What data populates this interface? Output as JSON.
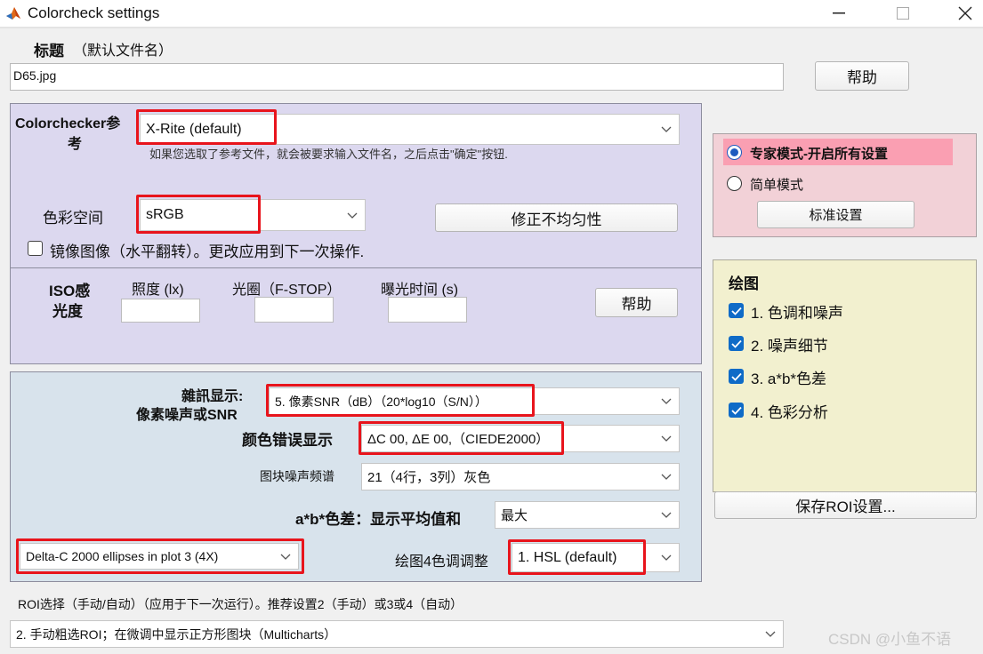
{
  "window": {
    "title": "Colorcheck settings",
    "controls": {
      "minimize": "–",
      "maximize": "☐",
      "close": "✕"
    }
  },
  "title_section": {
    "label": "标题",
    "label_hint": "（默认文件名）",
    "value": "D65.jpg",
    "help_button": "帮助"
  },
  "reference": {
    "label_line1": "Colorchecker参",
    "label_line2": "考",
    "select_value": "X-Rite (default)",
    "hint": "如果您选取了参考文件，就会被要求输入文件名，之后点击\"确定\"按钮.",
    "colorspace_label": "色彩空间",
    "colorspace_value": "sRGB",
    "nonuniformity_button": "修正不均匀性",
    "mirror_label": "镜像图像（水平翻转）。更改应用到下一次操作.",
    "mirror_checked": false
  },
  "exposure": {
    "iso_line1": "ISO感",
    "iso_line2": "光度",
    "illuminance_label": "照度 (lx)",
    "aperture_label": "光圈（F-STOP）",
    "exposure_time_label": "曝光时间 (s)",
    "illuminance_value": "",
    "aperture_value": "",
    "exposure_time_value": "",
    "help_button": "帮助"
  },
  "display": {
    "noise_label_line1": "雜訊显示:",
    "noise_label_line2": "像素噪声或SNR",
    "noise_value": "5. 像素SNR（dB）（20*log10（S/N））",
    "color_error_label": "颜色错误显示",
    "color_error_value": "ΔC 00, ΔE 00,（CIEDE2000）",
    "patch_spectrum_label": "图块噪声频谱",
    "patch_spectrum_value": "21（4行，3列）灰色",
    "ab_label": "a*b*色差：显示平均值和",
    "ab_value": "最大",
    "ellipse_value": "Delta-C 2000 ellipses in plot 3 (4X)",
    "plot4_label": "绘图4色调调整",
    "plot4_value": "1. HSL (default)"
  },
  "mode": {
    "expert_label": "专家模式-开启所有设置",
    "simple_label": "简单模式",
    "selected": "expert",
    "standard_button": "标准设置"
  },
  "plots": {
    "heading": "绘图",
    "items": [
      {
        "label": "1. 色调和噪声",
        "checked": true
      },
      {
        "label": "2. 噪声细节",
        "checked": true
      },
      {
        "label": "3. a*b*色差",
        "checked": true
      },
      {
        "label": "4. 色彩分析",
        "checked": true
      }
    ]
  },
  "save_roi_button": "保存ROI设置...",
  "roi": {
    "label": "ROI选择（手动/自动）（应用于下一次运行）。推荐设置2（手动）或3或4（自动）",
    "value": "2. 手动粗选ROI；在微调中显示正方形图块（Multicharts）"
  },
  "watermark": "CSDN @小鱼不语",
  "colors": {
    "reference_panel": "#dcd8ef",
    "display_panel": "#d8e3ec",
    "mode_panel": "#f2d1d7",
    "plot_panel": "#f2f0cf",
    "highlight_red": "#e8141c",
    "checkbox_blue": "#0f6bc7"
  }
}
